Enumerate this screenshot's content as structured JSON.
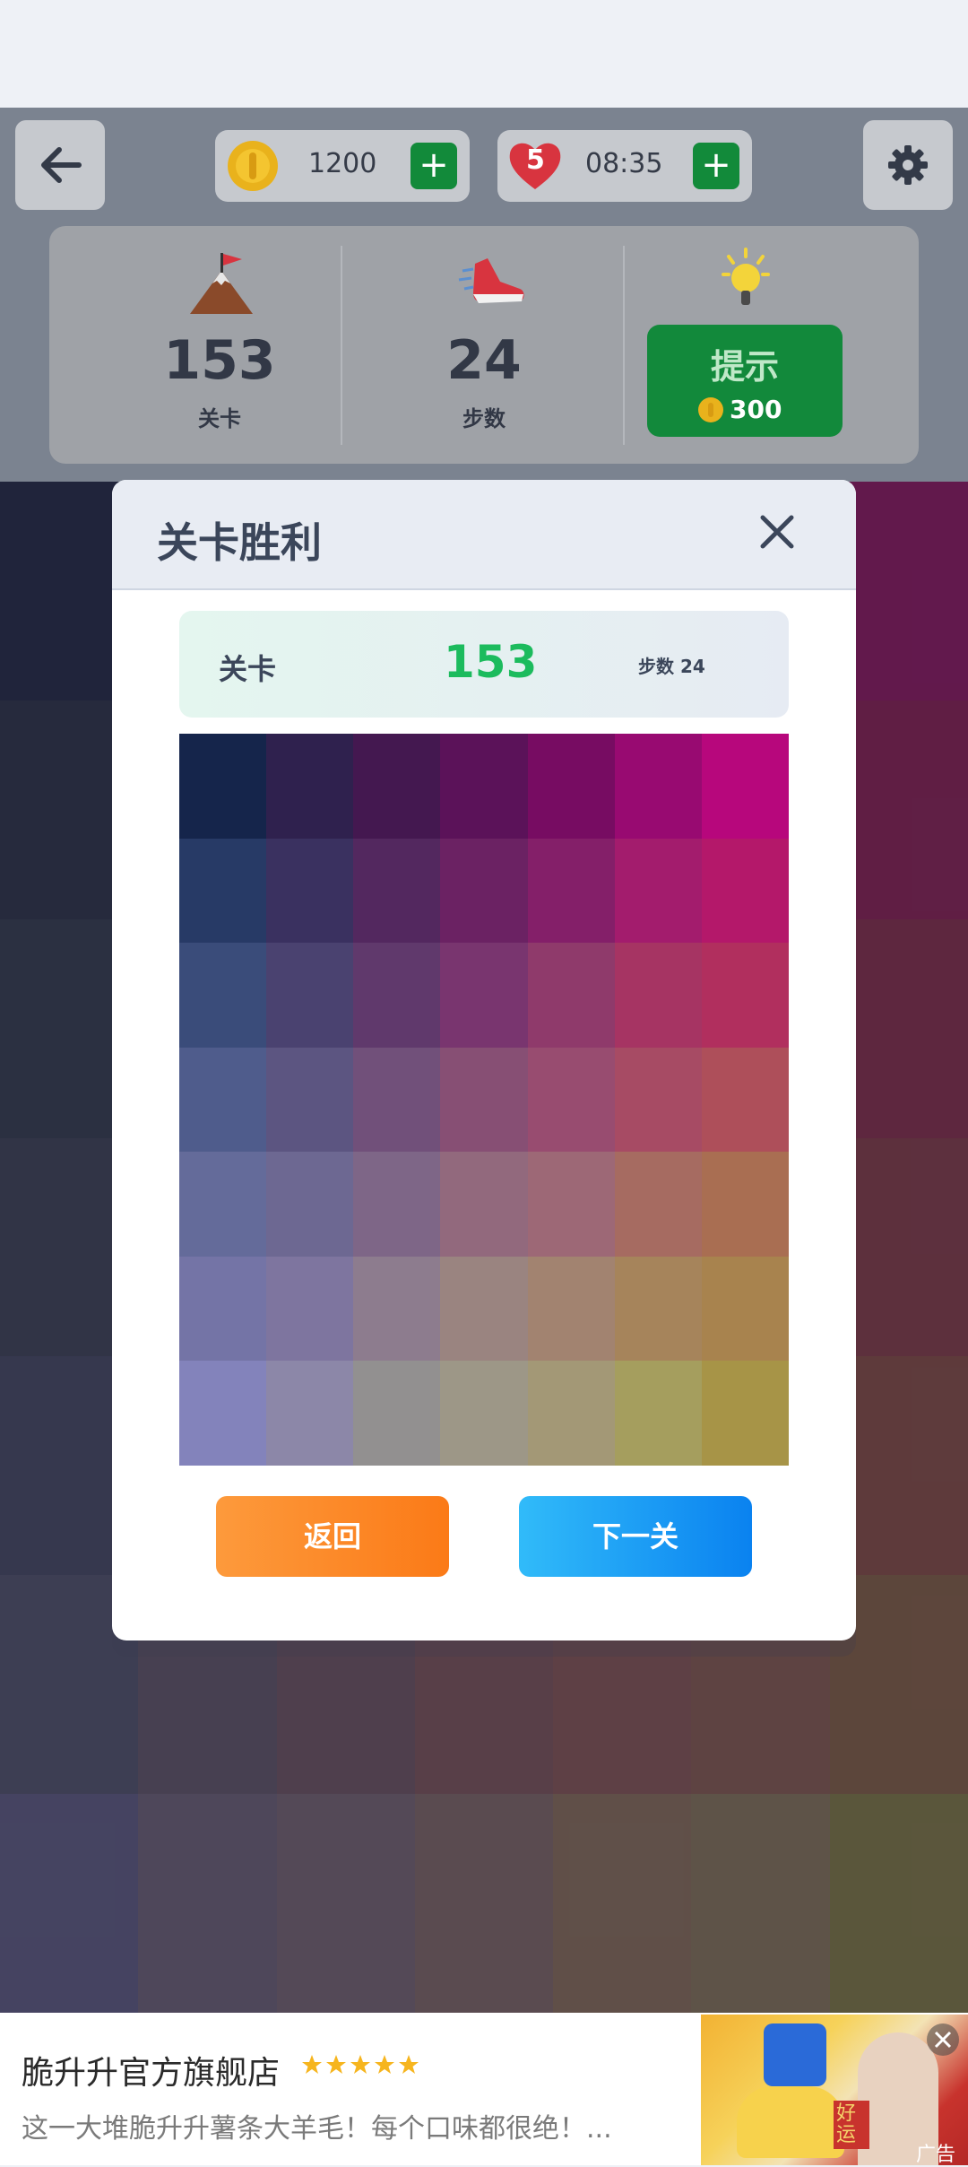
{
  "hud": {
    "coins": "1200",
    "lives": "5",
    "timer": "08:35",
    "plus": "+"
  },
  "stats": {
    "level_value": "153",
    "level_label": "关卡",
    "steps_value": "24",
    "steps_label": "步数",
    "hint_label": "提示",
    "hint_cost": "300"
  },
  "modal": {
    "title": "关卡胜利",
    "result_label": "关卡",
    "result_level": "153",
    "result_steps": "步数 24",
    "back_button": "返回",
    "next_button": "下一关"
  },
  "ad": {
    "title": "脆升升官方旗舰店",
    "rating_stars": 5,
    "description": "这一大堆脆升升薯条大羊毛！每个口味都很绝！...",
    "tag": "广告",
    "product_banner": "好运"
  },
  "colors": {
    "accent_green": "#12893b",
    "level_green": "#1cbb5d",
    "back_orange": "#fb8524",
    "next_blue": "#1a98f7",
    "bg_grid": [
      [
        "#111836",
        "#2a1a45",
        "#3d1546",
        "#4f0e4c",
        "#600a50",
        "#6c0850",
        "#770750"
      ],
      [
        "#1b2139",
        "#2d2444",
        "#3f1e48",
        "#521749",
        "#62124b",
        "#6f0f4a",
        "#730f44"
      ],
      [
        "#232a40",
        "#33294a",
        "#452648",
        "#55204a",
        "#641b46",
        "#6d1a43",
        "#701c3d"
      ],
      [
        "#2b3048",
        "#3c324d",
        "#4c2f4b",
        "#5b2a48",
        "#682744",
        "#6d2741",
        "#6f2a3a"
      ],
      [
        "#343753",
        "#433a51",
        "#53374d",
        "#613448",
        "#6c3444",
        "#6f343f",
        "#703a36"
      ],
      [
        "#3e3f5b",
        "#4d4258",
        "#5a4152",
        "#68414b",
        "#714346",
        "#714841",
        "#6e4c36"
      ],
      [
        "#4a4870",
        "#584e66",
        "#625062",
        "#6b5356",
        "#735a4b",
        "#70604a",
        "#6b6436"
      ]
    ],
    "mini_grid": [
      [
        "#15254b",
        "#2f214e",
        "#441850",
        "#5b1259",
        "#770c62",
        "#980a71",
        "#b7077c"
      ],
      [
        "#273a66",
        "#3a3160",
        "#53285f",
        "#6b2263",
        "#841f69",
        "#a31c6d",
        "#b4186a"
      ],
      [
        "#3a4c7a",
        "#4a4270",
        "#60396c",
        "#79356f",
        "#8f3a6b",
        "#a63463",
        "#b12f5e"
      ],
      [
        "#4f5c8c",
        "#5c5581",
        "#71507a",
        "#874f74",
        "#984c70",
        "#a74b64",
        "#ae4f5a"
      ],
      [
        "#646b9a",
        "#6d6892",
        "#7e6687",
        "#92697d",
        "#9d6876",
        "#a66b61",
        "#a96e52"
      ],
      [
        "#7474a6",
        "#7e759f",
        "#8d7c8e",
        "#9a8480",
        "#a28370",
        "#a6845b",
        "#a8834e"
      ],
      [
        "#8383bb",
        "#8c87a8",
        "#929090",
        "#9d9787",
        "#a39876",
        "#a59e5e",
        "#a79447"
      ]
    ]
  }
}
